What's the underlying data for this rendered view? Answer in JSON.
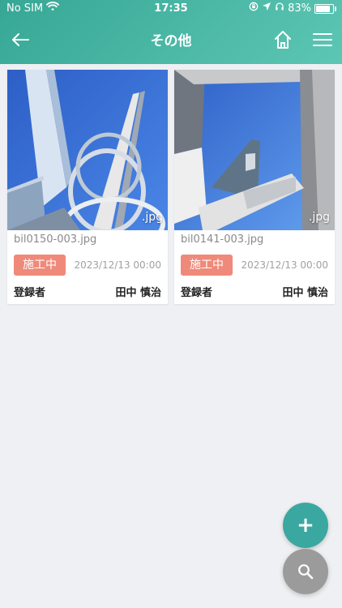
{
  "status_bar": {
    "carrier": "No SIM",
    "time": "17:35",
    "battery_percent": "83%",
    "battery_level": 0.83
  },
  "nav": {
    "title": "その他",
    "back_icon": "back-arrow-icon",
    "home_icon": "home-icon",
    "menu_icon": "menu-icon"
  },
  "cards": [
    {
      "file_name": "bil0150-003.jpg",
      "thumbnail_ext": ".jpg",
      "status": "施工中",
      "date": "2023/12/13 00:00",
      "registrant_label": "登録者",
      "registrant_name": "田中 慎治"
    },
    {
      "file_name": "bil0141-003.jpg",
      "thumbnail_ext": ".jpg",
      "status": "施工中",
      "date": "2023/12/13 00:00",
      "registrant_label": "登録者",
      "registrant_name": "田中 慎治"
    }
  ],
  "fab": {
    "add_label": "+"
  },
  "colors": {
    "header_start": "#37a795",
    "header_end": "#5dc6b4",
    "status_badge": "#ef8a7a",
    "fab_add": "#3aa8a0",
    "fab_search": "#9b9b9b",
    "background": "#eff0f3"
  }
}
